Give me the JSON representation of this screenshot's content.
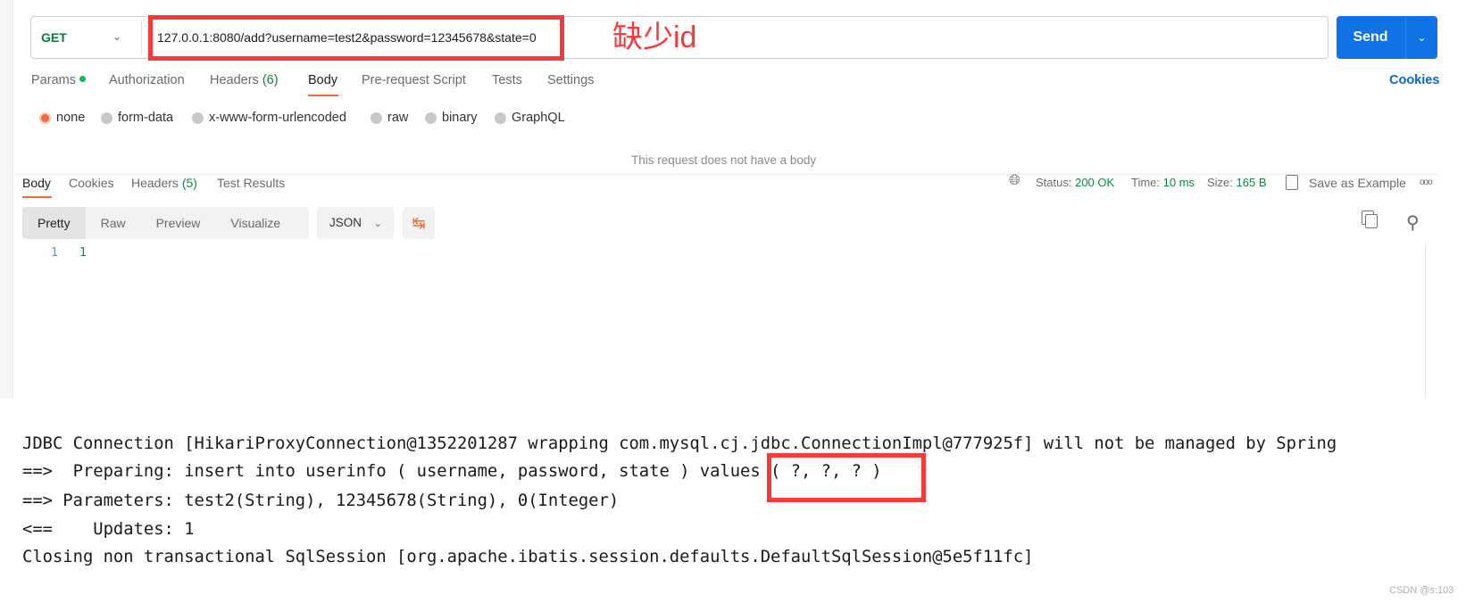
{
  "request": {
    "method": "GET",
    "url": "127.0.0.1:8080/add?username=test2&password=12345678&state=0",
    "send_label": "Send"
  },
  "annotation": {
    "note": "缺少id",
    "accent_color": "#f53a3a"
  },
  "request_tabs": [
    {
      "label": "Params"
    },
    {
      "label": "Authorization"
    },
    {
      "label": "Headers",
      "count": "(6)"
    },
    {
      "label": "Body"
    },
    {
      "label": "Pre-request Script"
    },
    {
      "label": "Tests"
    },
    {
      "label": "Settings"
    }
  ],
  "cookies_label": "Cookies",
  "body_modes": [
    "none",
    "form-data",
    "x-www-form-urlencoded",
    "raw",
    "binary",
    "GraphQL"
  ],
  "selected_body_mode": "none",
  "no_body_text": "This request does not have a body",
  "response": {
    "tabs": [
      {
        "label": "Body"
      },
      {
        "label": "Cookies"
      },
      {
        "label": "Headers",
        "count": "(5)"
      },
      {
        "label": "Test Results"
      }
    ],
    "status_label": "Status:",
    "status": "200 OK",
    "time_label": "Time:",
    "time": "10 ms",
    "size_label": "Size:",
    "size": "165 B",
    "save_label": "Save as Example",
    "views": [
      "Pretty",
      "Raw",
      "Preview",
      "Visualize"
    ],
    "format": "JSON",
    "lines": [
      {
        "num": "1",
        "text": "1"
      }
    ]
  },
  "console": [
    "JDBC Connection [HikariProxyConnection@1352201287 wrapping com.mysql.cj.jdbc.ConnectionImpl@777925f] will not be managed by Spring",
    "==>  Preparing: insert into userinfo ( username, password, state ) values ( ?, ?, ? )",
    "==> Parameters: test2(String), 12345678(String), 0(Integer)",
    "<==    Updates: 1",
    "Closing non transactional SqlSession [org.apache.ibatis.session.defaults.DefaultSqlSession@5e5f11fc]"
  ],
  "watermark": "CSDN @s:103"
}
